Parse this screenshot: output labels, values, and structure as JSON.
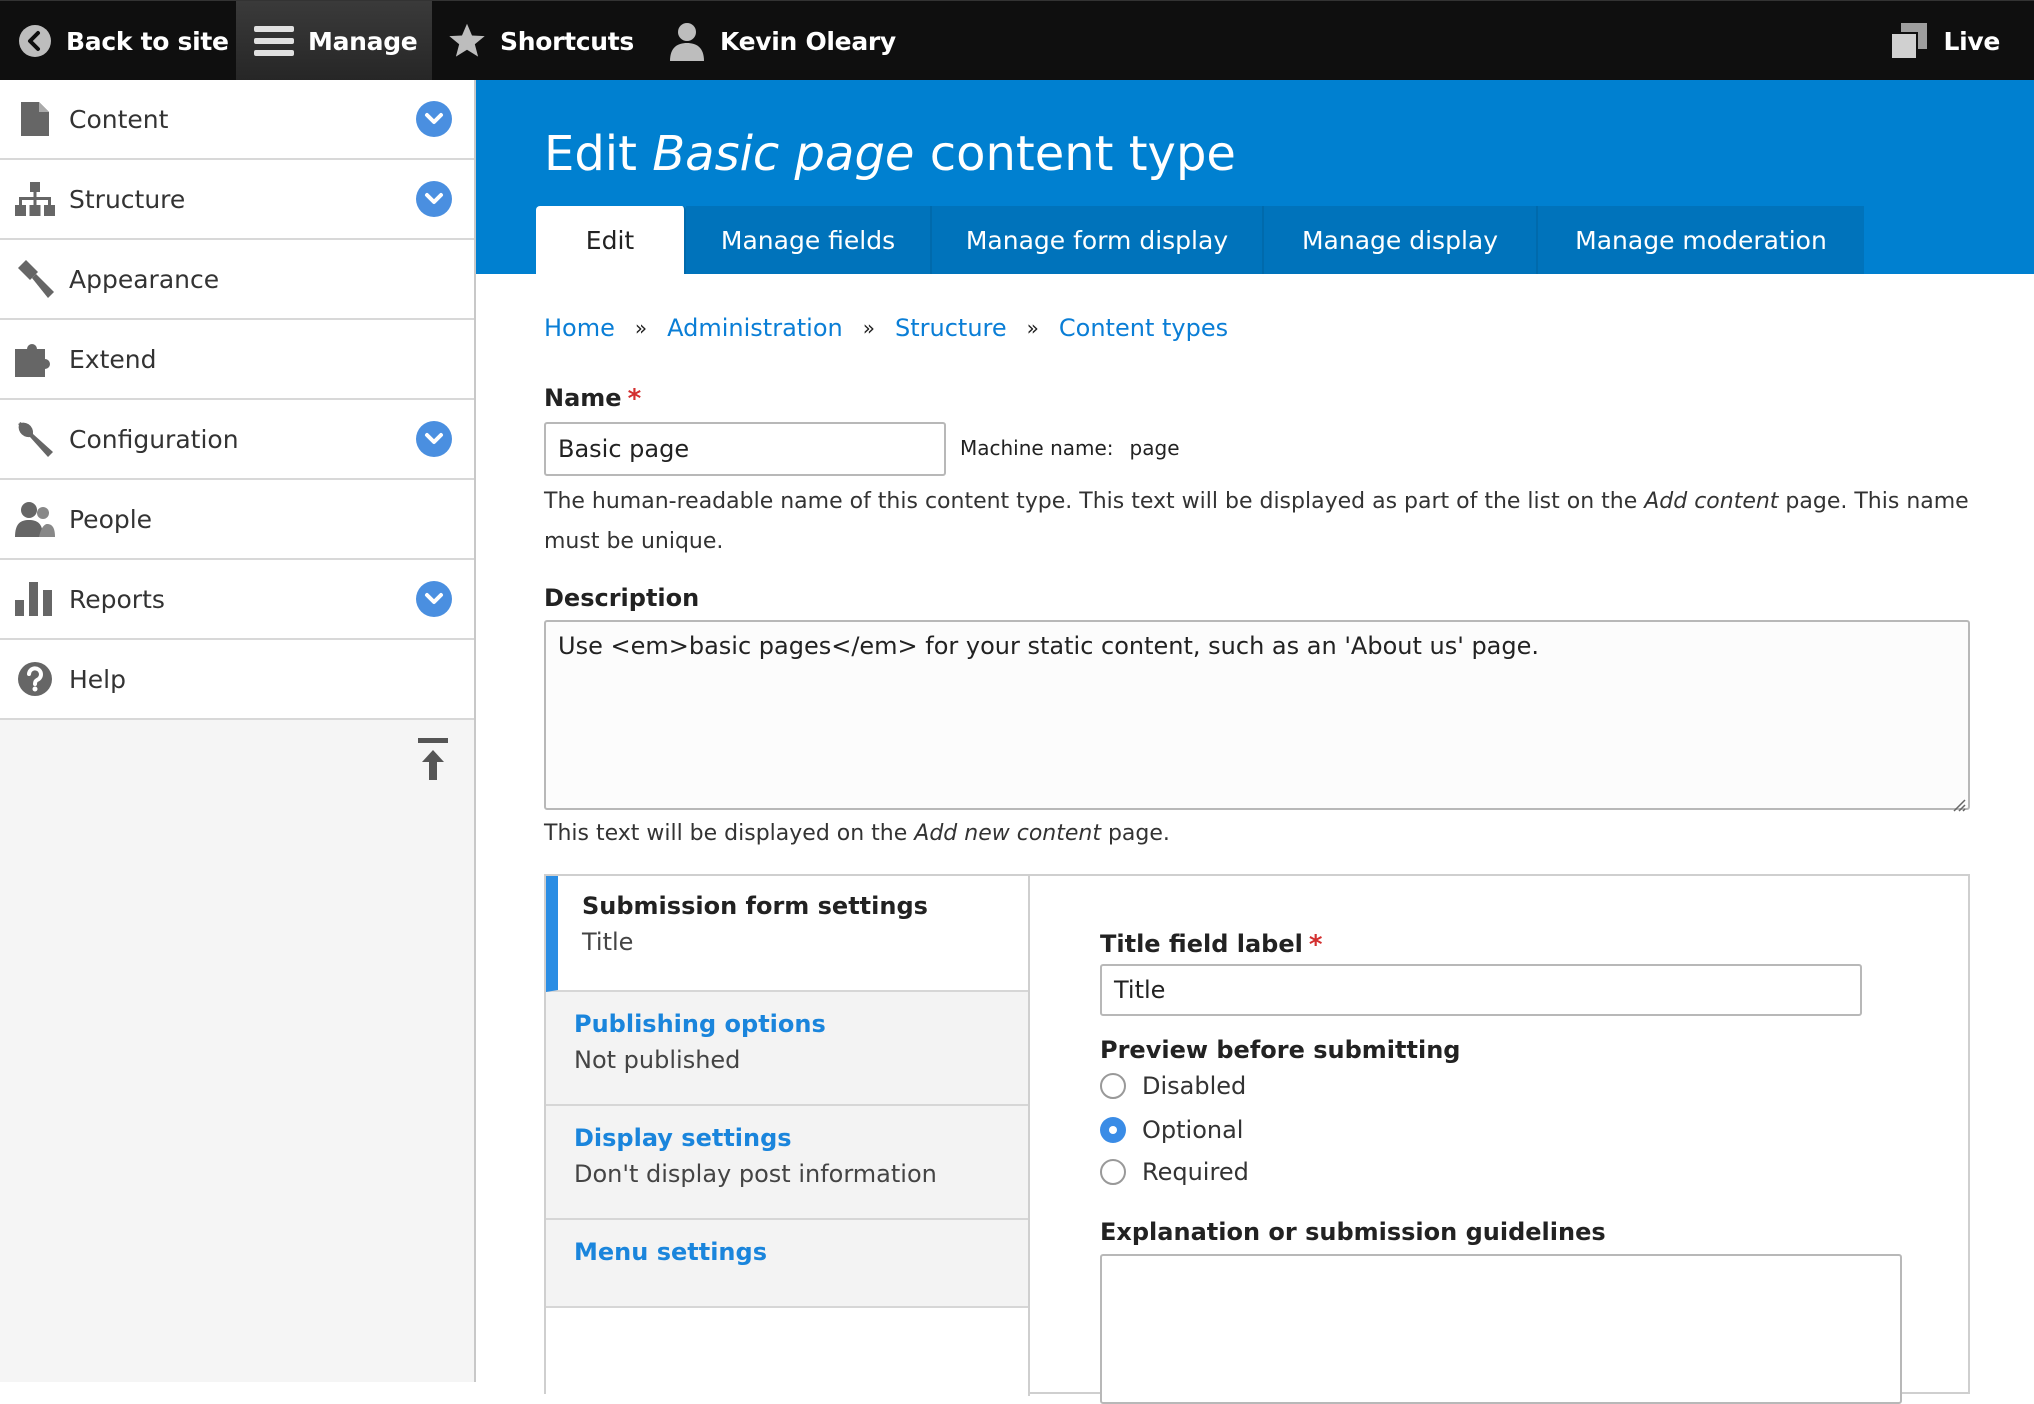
{
  "toolbar": {
    "back_label": "Back to site",
    "manage_label": "Manage",
    "shortcuts_label": "Shortcuts",
    "user_label": "Kevin Oleary",
    "live_label": "Live"
  },
  "sidebar": {
    "items": [
      {
        "label": "Content",
        "icon": "document-icon",
        "expandable": true
      },
      {
        "label": "Structure",
        "icon": "sitemap-icon",
        "expandable": true
      },
      {
        "label": "Appearance",
        "icon": "brush-icon",
        "expandable": false
      },
      {
        "label": "Extend",
        "icon": "puzzle-icon",
        "expandable": false
      },
      {
        "label": "Configuration",
        "icon": "wrench-icon",
        "expandable": true
      },
      {
        "label": "People",
        "icon": "people-icon",
        "expandable": false
      },
      {
        "label": "Reports",
        "icon": "bar-chart-icon",
        "expandable": true
      },
      {
        "label": "Help",
        "icon": "help-icon",
        "expandable": false
      }
    ]
  },
  "header": {
    "title_prefix": "Edit ",
    "title_emphasis": "Basic page",
    "title_suffix": " content type",
    "tabs": [
      {
        "label": "Edit",
        "active": true
      },
      {
        "label": "Manage fields",
        "active": false
      },
      {
        "label": "Manage form display",
        "active": false
      },
      {
        "label": "Manage display",
        "active": false
      },
      {
        "label": "Manage moderation",
        "active": false
      }
    ]
  },
  "breadcrumb": [
    "Home",
    "Administration",
    "Structure",
    "Content types"
  ],
  "breadcrumb_separator": "»",
  "form": {
    "name_label": "Name",
    "required_mark": "*",
    "name_value": "Basic page",
    "machine_name_label": "Machine name:",
    "machine_name_value": "page",
    "name_desc_1": "The human-readable name of this content type. This text will be displayed as part of the list on the ",
    "name_desc_em": "Add content",
    "name_desc_2": " page. This name must be unique.",
    "description_label": "Description",
    "description_value": "Use <em>basic pages</em> for your static content, such as an 'About us' page.",
    "description_help_1": "This text will be displayed on the ",
    "description_help_em": "Add new content",
    "description_help_2": " page."
  },
  "vertical_tabs": [
    {
      "title": "Submission form settings",
      "summary": "Title",
      "active": true
    },
    {
      "title": "Publishing options",
      "summary": "Not published",
      "active": false
    },
    {
      "title": "Display settings",
      "summary": "Don't display post information",
      "active": false
    },
    {
      "title": "Menu settings",
      "summary": "",
      "active": false
    }
  ],
  "submission": {
    "title_label": "Title field label",
    "title_value": "Title",
    "preview_label": "Preview before submitting",
    "preview_options": [
      "Disabled",
      "Optional",
      "Required"
    ],
    "preview_selected": "Optional",
    "guidelines_label": "Explanation or submission guidelines",
    "guidelines_value": ""
  },
  "colors": {
    "toolbar_bg": "#0f0f0f",
    "header_bg": "#0080d0",
    "link": "#0a7ed6",
    "required": "#d32f2f",
    "active_tab_bar": "#2a8de4"
  }
}
